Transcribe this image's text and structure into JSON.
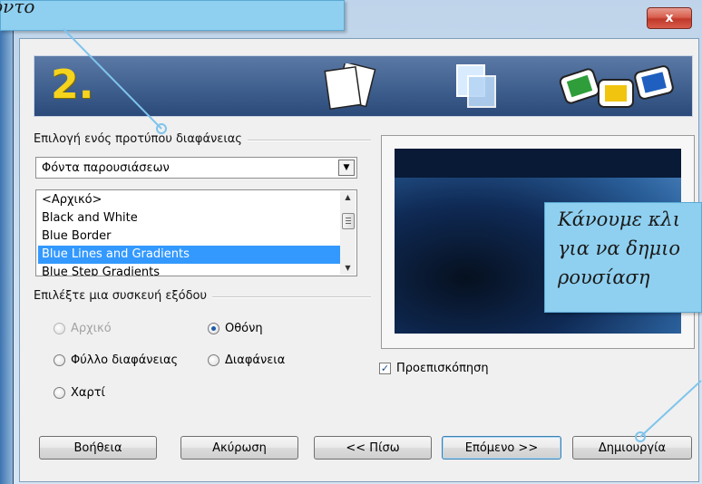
{
  "callouts": {
    "top_text": "ύντο",
    "right_lines": [
      "Κάνουμε κλι",
      "για να δημιο",
      "ρουσίαση"
    ]
  },
  "window": {
    "close_label": "x"
  },
  "banner": {
    "step_number": "2."
  },
  "template_group": {
    "label": "Επιλογή ενός προτύπου διαφάνειας",
    "category_selected": "Φόντα παρουσιάσεων",
    "templates": [
      "<Αρχικό>",
      "Black and White",
      "Blue Border",
      "Blue Lines and Gradients",
      "Blue Step Gradients"
    ],
    "selected_template": "Blue Lines and Gradients"
  },
  "output_group": {
    "label": "Επιλέξτε μια συσκευή εξόδου",
    "options": {
      "original": "Αρχικό",
      "screen": "Οθόνη",
      "overhead": "Φύλλο διαφάνειας",
      "slide": "Διαφάνεια",
      "paper": "Χαρτί"
    },
    "selected": "Οθόνη"
  },
  "preview": {
    "checkbox_label": "Προεπισκόπηση",
    "checked": true
  },
  "buttons": {
    "help": "Βοήθεια",
    "cancel": "Ακύρωση",
    "back": "<< Πίσω",
    "next": "Επόμενο >>",
    "create": "Δημιουργία"
  },
  "colors": {
    "callout_fill": "#8fd0f0",
    "selection": "#3399ff",
    "step_number": "#f6d31c"
  },
  "icons": [
    "slides-stack-icon",
    "overlapping-frames-icon",
    "colored-slides-icon",
    "dropdown-arrow-icon",
    "checkmark-icon"
  ]
}
